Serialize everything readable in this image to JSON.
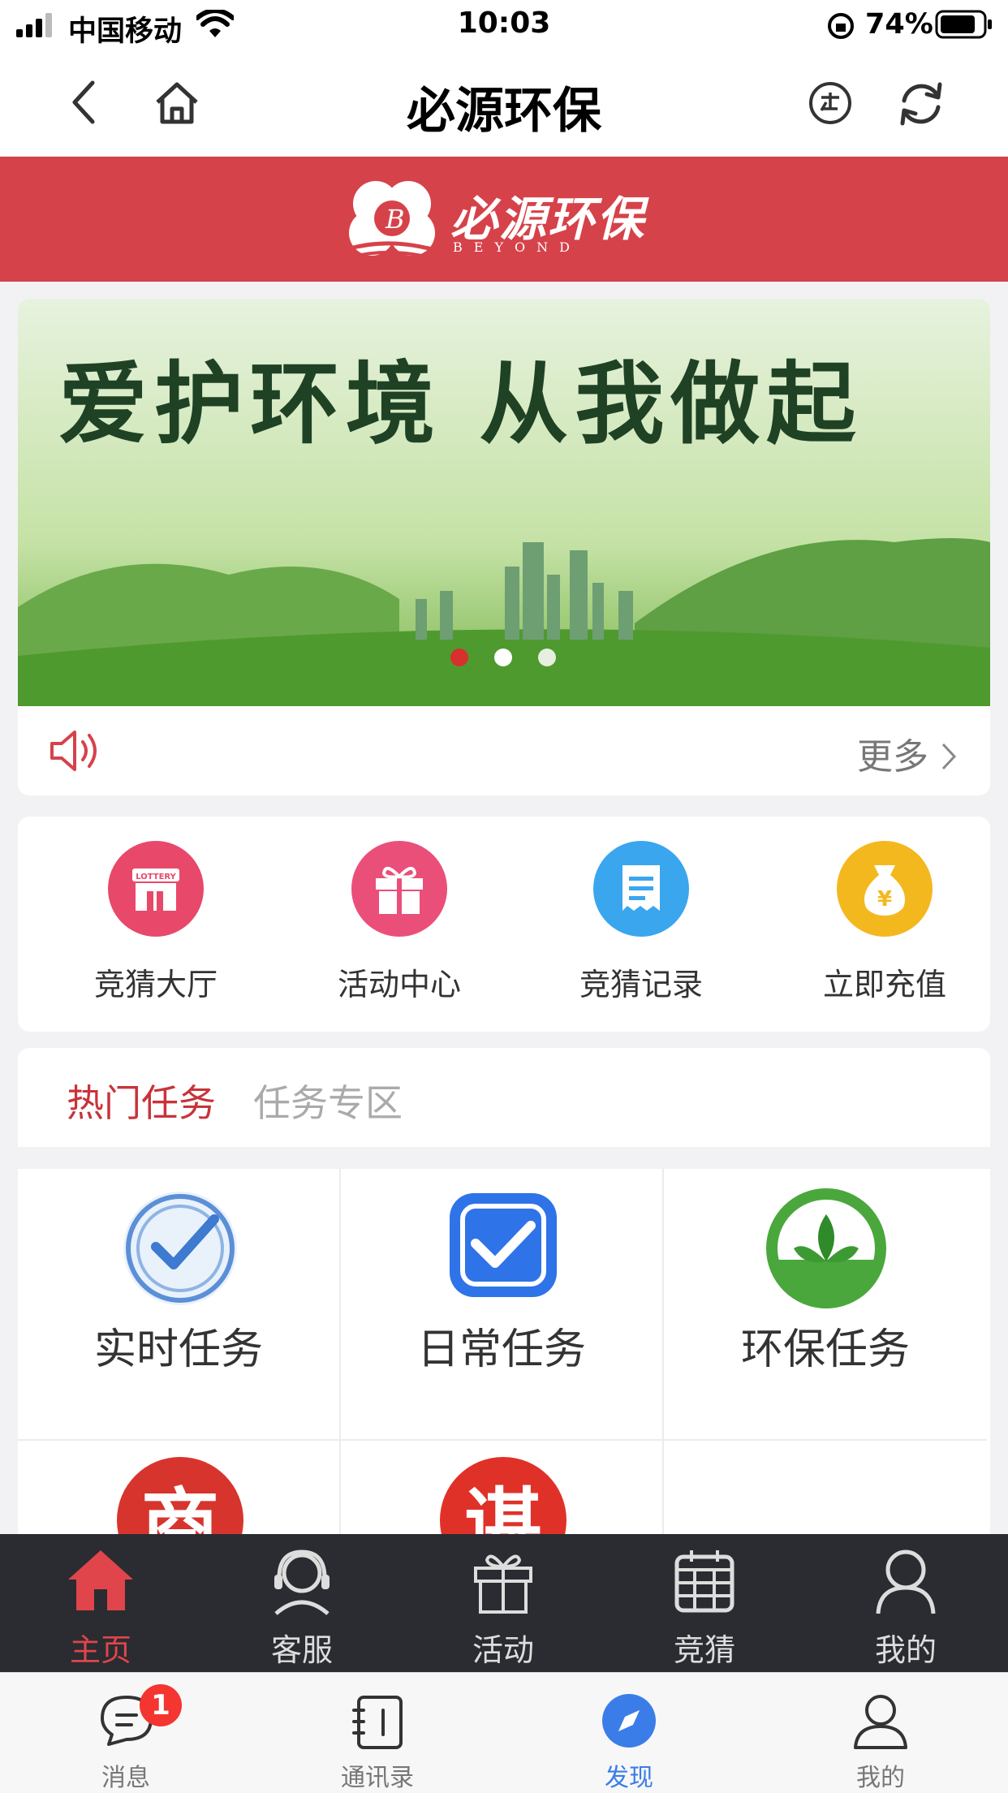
{
  "status_bar": {
    "carrier": "中国移动",
    "time": "10:03",
    "battery": "74%"
  },
  "nav": {
    "title": "必源环保"
  },
  "brand": {
    "name": "必源环保",
    "name_en": "BEYOND"
  },
  "hero": {
    "slogan": "爱护环境 从我做起",
    "slide_index": 1,
    "slide_count": 3
  },
  "notice": {
    "more_label": "更多"
  },
  "quick_menu": [
    {
      "label": "竞猜大厅",
      "icon": "lottery-shop-icon",
      "color": "#e8486a"
    },
    {
      "label": "活动中心",
      "icon": "gift-icon",
      "color": "#ea4f7a"
    },
    {
      "label": "竞猜记录",
      "icon": "receipt-icon",
      "color": "#3aa6ee"
    },
    {
      "label": "立即充值",
      "icon": "money-bag-icon",
      "color": "#f4b81f"
    }
  ],
  "task_tabs": [
    {
      "label": "热门任务",
      "active": true
    },
    {
      "label": "任务专区",
      "active": false
    }
  ],
  "tasks": [
    {
      "label": "实时任务",
      "icon": "clock-check-icon"
    },
    {
      "label": "日常任务",
      "icon": "calendar-check-icon"
    },
    {
      "label": "环保任务",
      "icon": "leaf-icon"
    },
    {
      "label": "商",
      "icon": "shop-icon"
    },
    {
      "label": "谌",
      "icon": "recruit-icon"
    }
  ],
  "app_tabs": [
    {
      "label": "主页",
      "icon": "home-icon",
      "active": true
    },
    {
      "label": "客服",
      "icon": "headset-icon",
      "active": false
    },
    {
      "label": "活动",
      "icon": "gift-icon",
      "active": false
    },
    {
      "label": "竞猜",
      "icon": "calendar-icon",
      "active": false
    },
    {
      "label": "我的",
      "icon": "user-icon",
      "active": false
    }
  ],
  "wechat_tabs": [
    {
      "label": "消息",
      "badge": "1"
    },
    {
      "label": "通讯录"
    },
    {
      "label": "发现",
      "active": true
    },
    {
      "label": "我的"
    }
  ],
  "colors": {
    "brand_red": "#d6424a",
    "active_red": "#e0454b",
    "wx_blue": "#3b7de8"
  }
}
